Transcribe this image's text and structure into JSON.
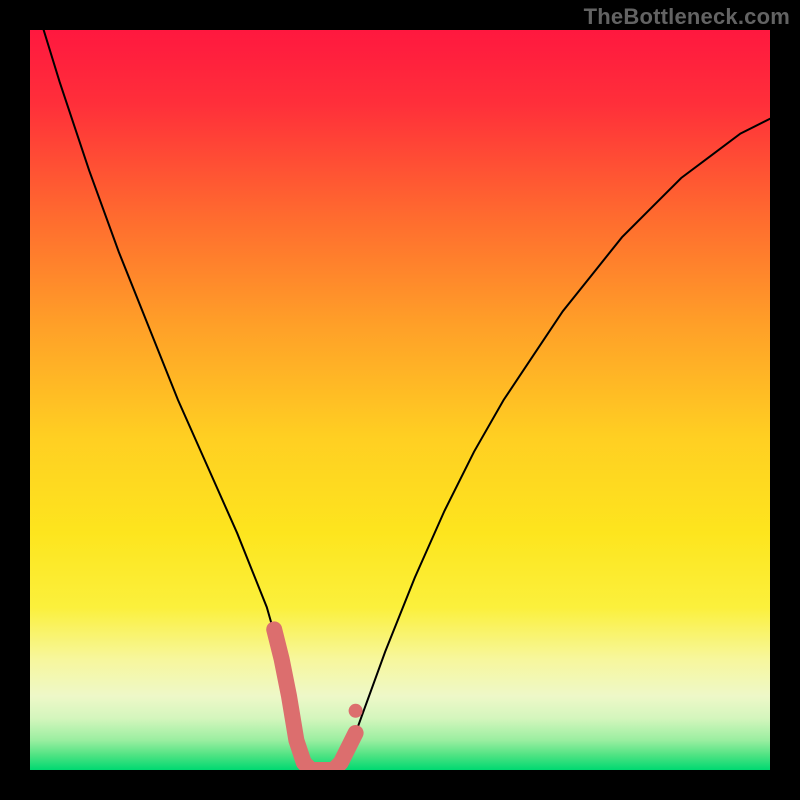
{
  "watermark": "TheBottleneck.com",
  "chart_data": {
    "type": "line",
    "title": "",
    "xlabel": "",
    "ylabel": "",
    "xlim": [
      0,
      100
    ],
    "ylim": [
      0,
      100
    ],
    "background_gradient": {
      "top_color": "#ff1a3a",
      "mid_color": "#ffd600",
      "bottom_color": "#00e676"
    },
    "series": [
      {
        "name": "bottleneck-curve",
        "x": [
          0,
          4,
          8,
          12,
          16,
          20,
          24,
          28,
          30,
          32,
          34,
          35,
          36,
          37,
          38,
          39,
          40,
          41,
          42,
          44,
          48,
          52,
          56,
          60,
          64,
          68,
          72,
          76,
          80,
          84,
          88,
          92,
          96,
          100
        ],
        "y": [
          106,
          93,
          81,
          70,
          60,
          50,
          41,
          32,
          27,
          22,
          15,
          10,
          4,
          1,
          0,
          0,
          0,
          0,
          1,
          5,
          16,
          26,
          35,
          43,
          50,
          56,
          62,
          67,
          72,
          76,
          80,
          83,
          86,
          88
        ],
        "stroke": "#000000",
        "stroke_width": 2
      },
      {
        "name": "highlight-valley",
        "x": [
          33,
          34,
          35,
          36,
          37,
          38,
          39,
          40,
          41,
          42,
          43,
          44
        ],
        "y": [
          19,
          15,
          10,
          4,
          1,
          0,
          0,
          0,
          0,
          1,
          3,
          5
        ],
        "stroke": "#dc6e6e",
        "stroke_width": 16,
        "highlight_dot": {
          "x": 44,
          "y": 8
        }
      }
    ]
  }
}
